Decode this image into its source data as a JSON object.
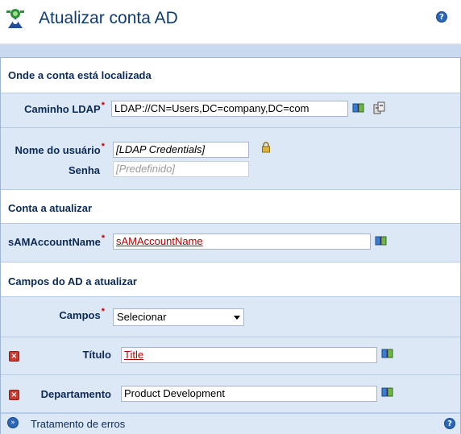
{
  "header": {
    "title": "Atualizar conta AD",
    "help_glyph": "?"
  },
  "location_section": {
    "title": "Onde a conta está localizada",
    "ldap_label": "Caminho LDAP",
    "ldap_value": "LDAP://CN=Users,DC=company,DC=com",
    "username_label": "Nome do usuário",
    "username_value": "[LDAP Credentials]",
    "password_label": "Senha",
    "password_placeholder": "[Predefinido]"
  },
  "account_section": {
    "title": "Conta a atualizar",
    "sam_label": "sAMAccountName",
    "sam_value": "sAMAccountName"
  },
  "fields_section": {
    "title": "Campos do AD a atualizar",
    "fields_label": "Campos",
    "fields_select_value": "Selecionar",
    "title_label": "Título",
    "title_value": "Title",
    "department_label": "Departamento",
    "department_value": "Product Development"
  },
  "footer": {
    "label": "Tratamento de erros",
    "chevron_glyph": "»",
    "help_glyph": "?"
  },
  "required_marker": "*",
  "delete_glyph": "×"
}
